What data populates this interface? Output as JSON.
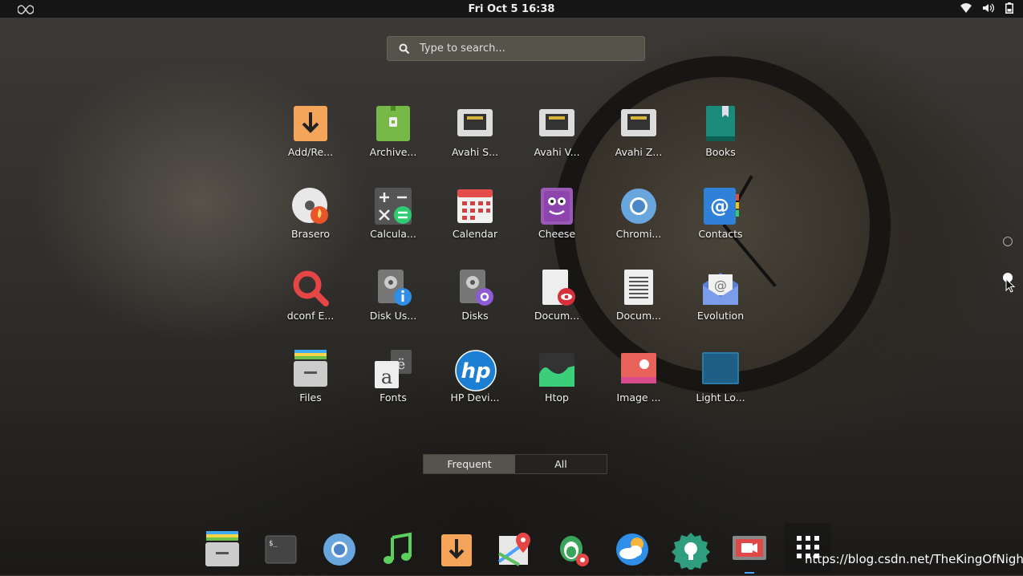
{
  "topbar": {
    "clock": "Fri Oct 5  16:38"
  },
  "search": {
    "placeholder": "Type to search..."
  },
  "apps": [
    {
      "label": "Add/Re..."
    },
    {
      "label": "Archive..."
    },
    {
      "label": "Avahi S..."
    },
    {
      "label": "Avahi V..."
    },
    {
      "label": "Avahi Z..."
    },
    {
      "label": "Books"
    },
    {
      "label": "Brasero"
    },
    {
      "label": "Calcula..."
    },
    {
      "label": "Calendar"
    },
    {
      "label": "Cheese"
    },
    {
      "label": "Chromi..."
    },
    {
      "label": "Contacts"
    },
    {
      "label": "dconf E..."
    },
    {
      "label": "Disk Us..."
    },
    {
      "label": "Disks"
    },
    {
      "label": "Docum..."
    },
    {
      "label": "Docum..."
    },
    {
      "label": "Evolution"
    },
    {
      "label": "Files"
    },
    {
      "label": "Fonts"
    },
    {
      "label": "HP Devi..."
    },
    {
      "label": "Htop"
    },
    {
      "label": "Image ..."
    },
    {
      "label": "Light Lo..."
    }
  ],
  "tabs": {
    "frequent": "Frequent",
    "all": "All",
    "active": "frequent"
  },
  "dock": {
    "items": [
      "files-icon",
      "terminal-icon",
      "chromium-icon",
      "music-icon",
      "software-install-icon",
      "maps-icon",
      "tweaks-icon",
      "weather-icon",
      "settings-icon",
      "screen-recorder-icon"
    ],
    "show_apps": "show-applications-icon"
  },
  "watermark": "https://blog.csdn.net/TheKingOfNight"
}
